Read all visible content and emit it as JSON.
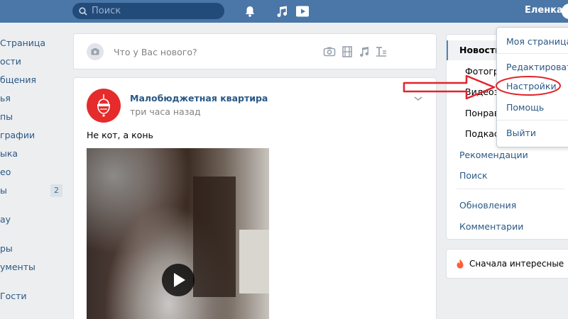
{
  "header": {
    "search_placeholder": "Поиск",
    "user_name": "Еленка",
    "icons": [
      "search-icon",
      "bell-icon",
      "music-icon",
      "video-play-icon"
    ]
  },
  "left_menu": {
    "items": [
      {
        "label": "Страница"
      },
      {
        "label": "ости"
      },
      {
        "label": "бщения"
      },
      {
        "label": "ья"
      },
      {
        "label": "пы"
      },
      {
        "label": "графии"
      },
      {
        "label": "ыка"
      },
      {
        "label": "ео"
      },
      {
        "label": "ы",
        "badge": "2"
      },
      {
        "label": "ay"
      },
      {
        "label": "ры"
      },
      {
        "label": "ументы"
      },
      {
        "label": "Гости"
      }
    ]
  },
  "composer": {
    "placeholder": "Что у Вас нового?",
    "icons": [
      "photo-icon",
      "video-icon",
      "audio-icon",
      "article-icon",
      "art-icon"
    ]
  },
  "post": {
    "author": "Малобюджетная квартира",
    "time": "три часа назад",
    "text": "Не кот, а конь"
  },
  "right_nav": {
    "active": "Новости",
    "sub_items": [
      "Фотогра",
      "Видеоз",
      "Понрав",
      "Подкаст"
    ],
    "items_group1": [
      "Рекомендации",
      "Поиск"
    ],
    "items_group2": [
      "Обновления",
      "Комментарии"
    ]
  },
  "sort": {
    "label": "Сначала интересные"
  },
  "dropdown": {
    "items": [
      "Моя страница",
      "Редактировать",
      "Настройки",
      "Помощь",
      "Выйти"
    ]
  },
  "colors": {
    "header_bg": "#4a76a8",
    "link": "#2a5885",
    "annotation_red": "#e0242b"
  }
}
